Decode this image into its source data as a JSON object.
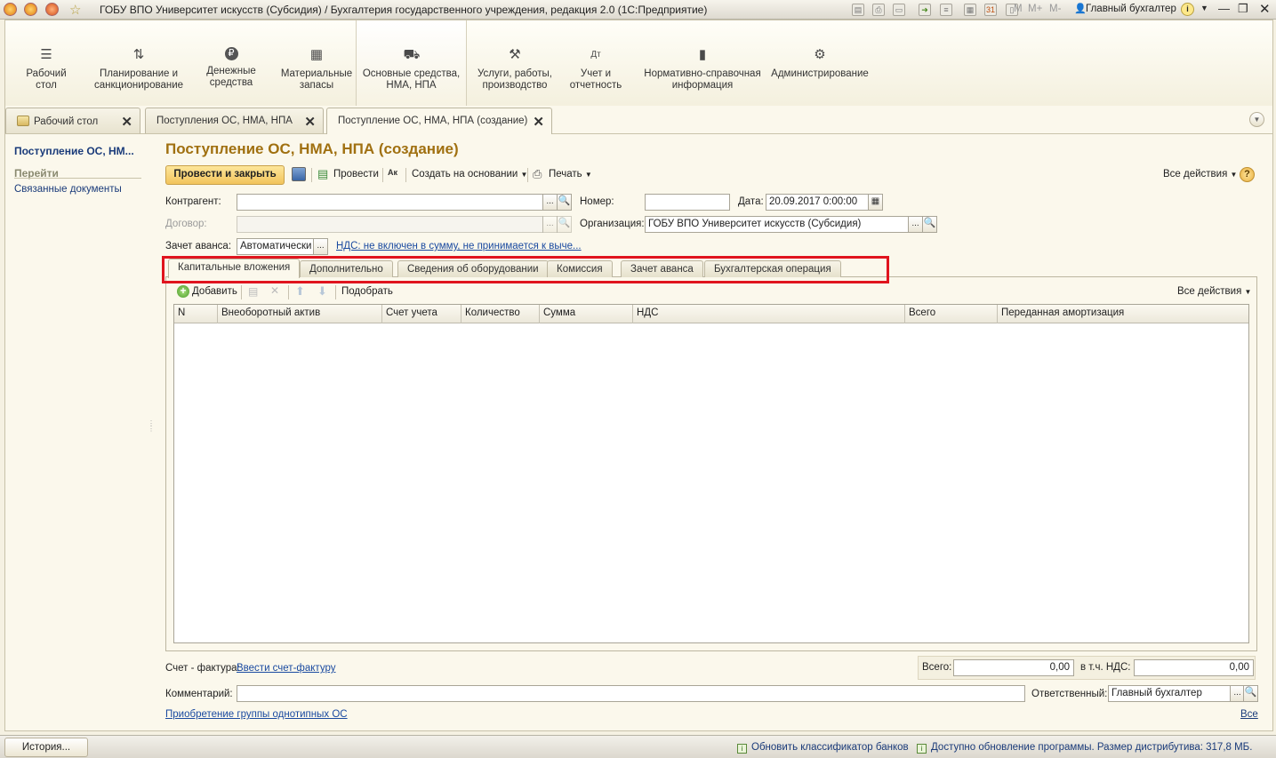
{
  "window": {
    "title": "ГОБУ ВПО Университет искусств (Субсидия) / Бухгалтерия государственного учреждения, редакция 2.0  (1С:Предприятие)",
    "user": "Главный бухгалтер",
    "toolbar_m": [
      "M",
      "M+",
      "M-"
    ]
  },
  "sections": [
    {
      "label": "Рабочий\nстол",
      "icon": "list-icon"
    },
    {
      "label": "Планирование и\nсанкционирование",
      "icon": "chart-icon"
    },
    {
      "label": "Денежные\nсредства",
      "icon": "ruble-icon"
    },
    {
      "label": "Материальные\nзапасы",
      "icon": "grid-icon"
    },
    {
      "label": "Основные средства,\nНМА, НПА",
      "icon": "truck-icon"
    },
    {
      "label": "Услуги, работы,\nпроизводство",
      "icon": "tools-icon"
    },
    {
      "label": "Учет и\nотчетность",
      "icon": "dtkt-icon"
    },
    {
      "label": "Нормативно-справочная\nинформация",
      "icon": "books-icon"
    },
    {
      "label": "Администрирование",
      "icon": "gear-icon"
    }
  ],
  "open_tabs": [
    "Рабочий стол",
    "Поступления ОС, НМА, НПА",
    "Поступление ОС, НМА, НПА (создание)"
  ],
  "left_panel": {
    "doc_name": "Поступление ОС, НМ...",
    "goto_header": "Перейти",
    "links": [
      "Связанные документы"
    ]
  },
  "form": {
    "title": "Поступление ОС, НМА, НПА (создание)",
    "toolbar": {
      "post_close": "Провести и закрыть",
      "post": "Провести",
      "create_based": "Создать на основании",
      "print": "Печать",
      "all_actions": "Все действия"
    },
    "fields": {
      "counterparty_label": "Контрагент:",
      "contract_label": "Договор:",
      "advance_label": "Зачет аванса:",
      "advance_value": "Автоматически",
      "vat_link": "НДС: не включен в сумму, не принимается к выче...",
      "number_label": "Номер:",
      "date_label": "Дата:",
      "date_value": "20.09.2017  0:00:00",
      "org_label": "Организация:",
      "org_value": "ГОБУ ВПО Университет искусств (Субсидия)"
    },
    "tabs": [
      "Капитальные вложения",
      "Дополнительно",
      "Сведения об оборудовании",
      "Комиссия",
      "Зачет аванса",
      "Бухгалтерская операция"
    ],
    "table_toolbar": {
      "add": "Добавить",
      "pick": "Подобрать",
      "all_actions": "Все действия"
    },
    "columns": [
      "N",
      "Внеоборотный актив",
      "Счет учета",
      "Количество",
      "Сумма",
      "НДС",
      "Всего",
      "Переданная амортизация"
    ],
    "invoice_label": "Счет - фактура:",
    "invoice_link": "Ввести счет-фактуру",
    "total_label": "Всего:",
    "total_value": "0,00",
    "vat_total_label": "в т.ч. НДС:",
    "vat_total_value": "0,00",
    "comment_label": "Комментарий:",
    "responsible_label": "Ответственный:",
    "responsible_value": "Главный бухгалтер",
    "bottom_link": "Приобретение группы однотипных ОС",
    "all_link": "Все"
  },
  "statusbar": {
    "history": "История...",
    "msg1": "Обновить классификатор банков",
    "msg2": "Доступно обновление программы. Размер дистрибутива: 317,8 МБ."
  }
}
